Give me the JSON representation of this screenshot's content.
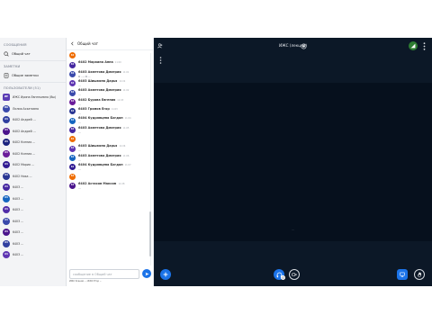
{
  "colors": {
    "primary": "#1b73e8",
    "main_background": "#0c1827",
    "presentation_background": "#06101d",
    "sidebar_background": "#f3f4f6",
    "badge_green": "#2e7d32"
  },
  "sidebar": {
    "messages_label": "СООБЩЕНИЯ",
    "public_chat_label": "Общий чат",
    "notes_label": "ЗАМЕТКИ",
    "shared_notes_label": "Общие заметки",
    "users_label": "ПОЛЬЗОВАТЕЛИ (51)",
    "users": [
      {
        "initials": "ИЕ",
        "name": "ИЖС Ирина Евгеньевна (Вы)",
        "color": "#5b3db5",
        "icon": "presenter"
      },
      {
        "initials": "ЛА",
        "name": "Лилия Асхатовна",
        "color": "#3949ab",
        "icon": "none"
      },
      {
        "initials": "64",
        "name": "6402 Андрей ...",
        "color": "#303f9f",
        "icon": "none"
      },
      {
        "initials": "64",
        "name": "6402 Андрей ...",
        "color": "#4a148c",
        "icon": "none"
      },
      {
        "initials": "64",
        "name": "6402 Ксения ...",
        "color": "#1a237e",
        "icon": "none"
      },
      {
        "initials": "64",
        "name": "6402 Ксения ...",
        "color": "#6a1b9a",
        "icon": "none"
      },
      {
        "initials": "64",
        "name": "6402 Мария ...",
        "color": "#311b92",
        "icon": "none"
      },
      {
        "initials": "64",
        "name": "6402 Ника ...",
        "color": "#283593",
        "icon": "none"
      },
      {
        "initials": "64",
        "name": "6403 ...",
        "color": "#4527a0",
        "icon": "none"
      },
      {
        "initials": "64",
        "name": "6403 ...",
        "color": "#1565c0",
        "icon": "none"
      },
      {
        "initials": "64",
        "name": "6403 ...",
        "color": "#512da8",
        "icon": "none"
      },
      {
        "initials": "64",
        "name": "6403 ...",
        "color": "#3949ab",
        "icon": "none"
      },
      {
        "initials": "64",
        "name": "6403 ...",
        "color": "#4a148c",
        "icon": "none"
      },
      {
        "initials": "64",
        "name": "6403 ...",
        "color": "#303f9f",
        "icon": "none"
      },
      {
        "initials": "64",
        "name": "6403 ...",
        "color": "#5e35b1",
        "icon": "none"
      }
    ]
  },
  "chat": {
    "title": "Общий чат",
    "messages": [
      {
        "initials": "64",
        "color": "#ef6c00",
        "author": "",
        "time": "",
        "text": ""
      },
      {
        "initials": "64",
        "color": "#4527a0",
        "author": "6402 Маркина Анна",
        "time": "11:00",
        "text": ""
      },
      {
        "initials": "64",
        "color": "#3949ab",
        "author": "6403 Ахметова Дмитрия",
        "time": "11:01",
        "text": "0 ...; 0 ..."
      },
      {
        "initials": "64",
        "color": "#5e35b1",
        "author": "6403 Шишкина Дарья",
        "time": "11:02",
        "text": "..."
      },
      {
        "initials": "64",
        "color": "#3949ab",
        "author": "6403 Ахметова Дмитрия",
        "time": "11:02",
        "text": "..."
      },
      {
        "initials": "64",
        "color": "#6a1b9a",
        "author": "6402 Бурова Евгения",
        "time": "11:03",
        "text": "..."
      },
      {
        "initials": "64",
        "color": "#283593",
        "author": "6403 Громов Егор",
        "time": "11:03",
        "text": "..."
      },
      {
        "initials": "64",
        "color": "#1565c0",
        "author": "6404 Кудрявцева Богдан",
        "time": "11:04",
        "text": "..."
      },
      {
        "initials": "64",
        "color": "#4527a0",
        "author": "6403 Ахметова Дмитрия",
        "time": "11:05",
        "text": "..."
      },
      {
        "initials": "64",
        "color": "#ef6c00",
        "author": "",
        "time": "",
        "text": ""
      },
      {
        "initials": "64",
        "color": "#5e35b1",
        "author": "6403 Шишкина Дарья",
        "time": "11:06",
        "text": "..."
      },
      {
        "initials": "64",
        "color": "#1565c0",
        "author": "6403 Ахметова Дмитрия",
        "time": "11:06",
        "text": "..."
      },
      {
        "initials": "64",
        "color": "#311b92",
        "author": "6404 Кудрявцева Богдан",
        "time": "11:07",
        "text": "..."
      },
      {
        "initials": "64",
        "color": "#ef6c00",
        "author": "",
        "time": "",
        "text": ""
      },
      {
        "initials": "64",
        "color": "#4a148c",
        "author": "6402 Астахов Максим",
        "time": "11:08",
        "text": "..."
      }
    ],
    "composer": {
      "placeholder": "сообщение в Общий чат",
      "value": ""
    },
    "typing_indicator": "ИЖС Ксения ...; ИЖС Егор ..."
  },
  "main": {
    "meeting_title": "ИЖС (лекция)",
    "presentation_hint": "..."
  }
}
